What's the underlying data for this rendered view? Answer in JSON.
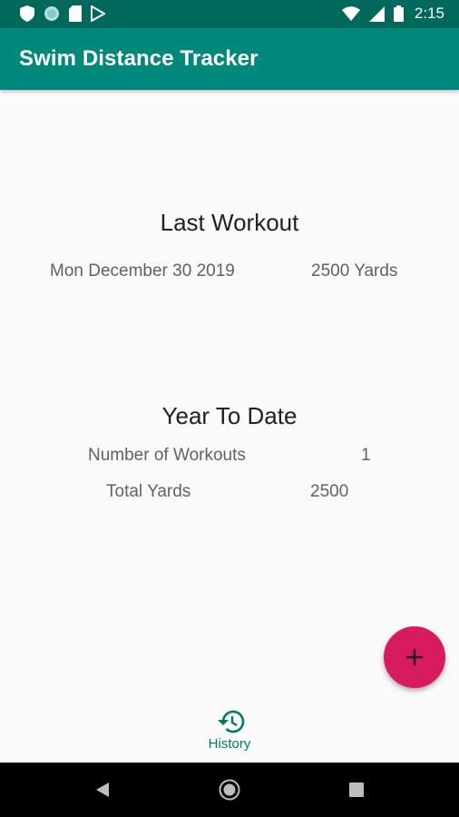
{
  "status_bar": {
    "time": "2:15",
    "left_icons": [
      "shield-icon",
      "circle-notification-icon",
      "sim-card-icon",
      "play-store-icon"
    ],
    "right_icons": [
      "wifi-icon",
      "signal-icon",
      "battery-icon"
    ]
  },
  "app_bar": {
    "title": "Swim Distance Tracker"
  },
  "last_workout": {
    "heading": "Last Workout",
    "date": "Mon December 30 2019",
    "distance": "2500 Yards"
  },
  "year_to_date": {
    "heading": "Year To Date",
    "rows": [
      {
        "label": "Number of Workouts",
        "value": "1"
      },
      {
        "label": "Total Yards",
        "value": "2500"
      }
    ]
  },
  "fab": {
    "icon": "plus-icon"
  },
  "bottom_nav": {
    "history_label": "History",
    "icon": "history-icon"
  },
  "colors": {
    "primary": "#00897b",
    "primary_dark": "#00695c",
    "accent": "#d81b60",
    "background": "#fafafa"
  }
}
